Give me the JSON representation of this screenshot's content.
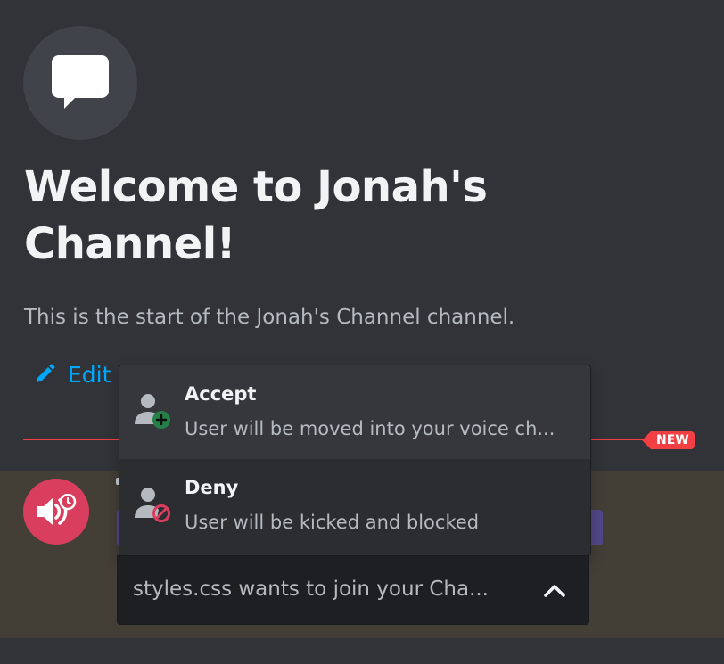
{
  "header": {
    "icon": "chat-bubble-icon",
    "title": "Welcome to Jonah's Channel!",
    "subtitle": "This is the start of the Jonah's Channel channel.",
    "edit_label": "Edit",
    "edit_icon": "pencil-icon"
  },
  "divider": {
    "badge": "NEW",
    "color": "#f23f43"
  },
  "message": {
    "avatar_icon": "voice-request-icon",
    "avatar_color": "#da3e5e",
    "tag_partial_text": "n"
  },
  "dropdown": {
    "options": [
      {
        "label": "Accept",
        "description": "User will be moved into your voice ch...",
        "icon": "user-add-icon",
        "icon_color": "#248046"
      },
      {
        "label": "Deny",
        "description": "User will be kicked and blocked",
        "icon": "user-block-icon",
        "icon_color": "#da3e5e"
      }
    ],
    "selected_value": "styles.css wants to join your Cha...",
    "chevron_icon": "chevron-up-icon"
  },
  "colors": {
    "background": "#313338",
    "link": "#00a8fc",
    "highlight_row": "#433f37"
  }
}
